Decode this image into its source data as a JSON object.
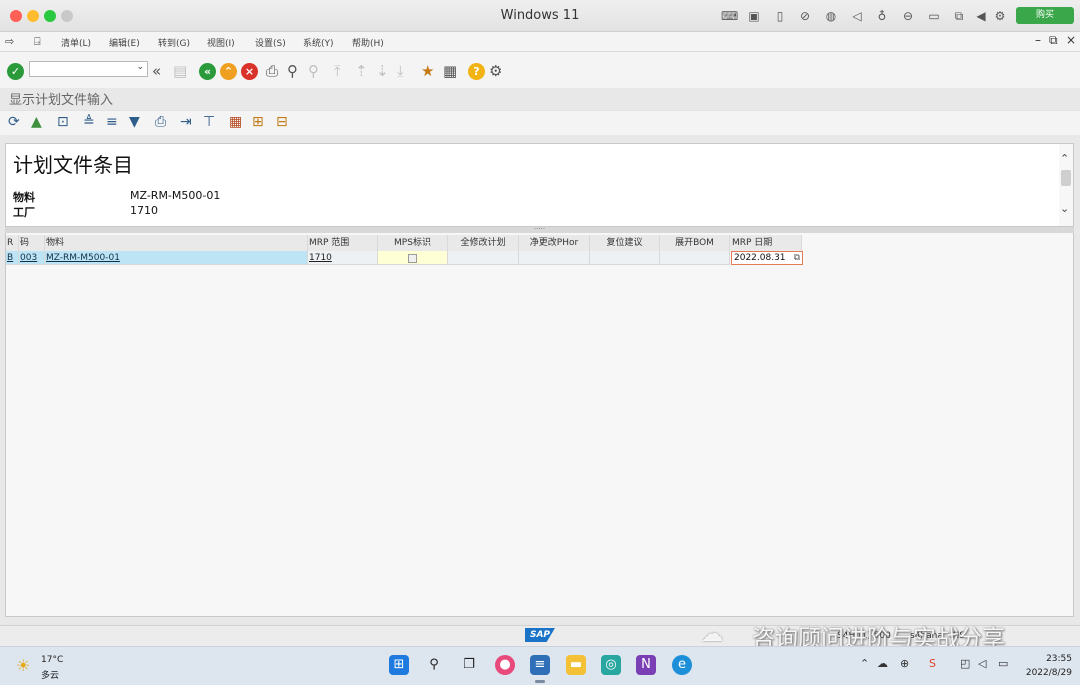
{
  "window": {
    "title": "Windows 11",
    "buy_label": "购买"
  },
  "menu": {
    "items": [
      "清单(L)",
      "编辑(E)",
      "转到(G)",
      "视图(I)",
      "设置(S)",
      "系统(Y)",
      "帮助(H)"
    ]
  },
  "screen": {
    "title": "显示计划文件输入"
  },
  "header": {
    "title": "计划文件条目",
    "material_label": "物料",
    "material_value": "MZ-RM-M500-01",
    "plant_label": "工厂",
    "plant_value": "1710"
  },
  "grid": {
    "columns": [
      "R",
      "码",
      "物料",
      "MRP 范围",
      "MPS标识",
      "全修改计划",
      "净更改PHor",
      "复位建议",
      "展开BOM",
      "MRP 日期"
    ],
    "rows": [
      {
        "r": "B",
        "code": "003",
        "material": "MZ-RM-M500-01",
        "mrp_area": "1710",
        "mrp_date": "2022.08.31"
      }
    ]
  },
  "statusbar": {
    "system": "S4H (1) 500",
    "server": "s4hana",
    "mode": "INS"
  },
  "watermark": "咨询顾问进阶与实战分享",
  "taskbar": {
    "temperature": "17°C",
    "condition": "多云",
    "time": "23:55",
    "date": "2022/8/29"
  },
  "colors": {
    "key_cell": "#bde4f4",
    "mps_cell": "#ffffd6",
    "accent_green": "#3aa84a",
    "sap_blue": "#1a73c6"
  }
}
